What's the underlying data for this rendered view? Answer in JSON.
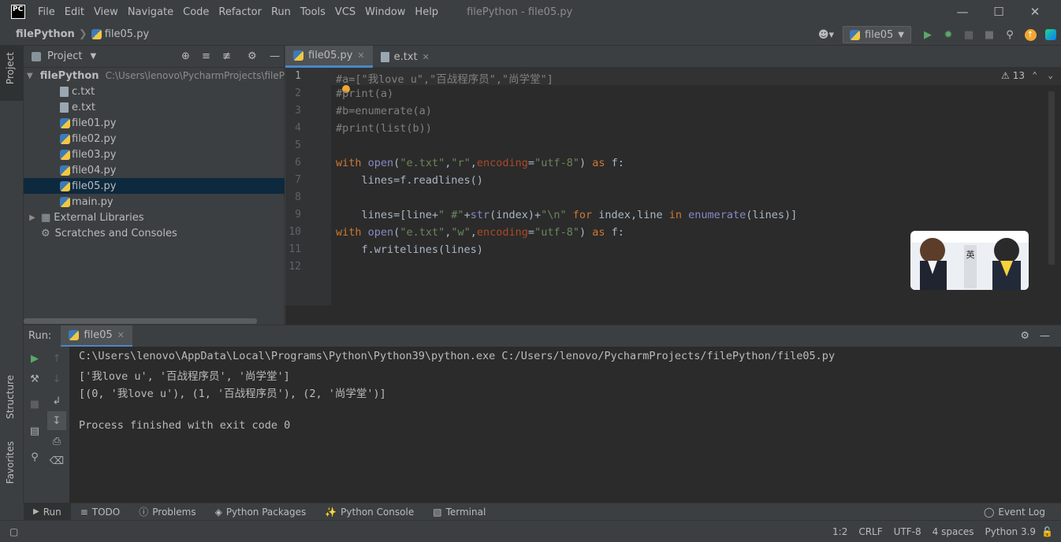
{
  "title_bar": {
    "logo": "PC",
    "menu": [
      "File",
      "Edit",
      "View",
      "Navigate",
      "Code",
      "Refactor",
      "Run",
      "Tools",
      "VCS",
      "Window",
      "Help"
    ],
    "window_title": "filePython - file05.py",
    "controls": [
      "minimize-icon",
      "maximize-icon",
      "close-icon"
    ]
  },
  "nav_bar": {
    "project": "filePython",
    "file": "file05.py",
    "run_config": "file05"
  },
  "left_stripe": {
    "tabs": [
      "Project",
      "Structure",
      "Favorites"
    ]
  },
  "project_panel": {
    "header": "Project",
    "root": {
      "name": "filePython",
      "path": "C:\\Users\\lenovo\\PycharmProjects\\fileP"
    },
    "files": [
      "c.txt",
      "e.txt",
      "file01.py",
      "file02.py",
      "file03.py",
      "file04.py",
      "file05.py",
      "main.py"
    ],
    "selected": "file05.py",
    "extra": [
      "External Libraries",
      "Scratches and Consoles"
    ]
  },
  "editor": {
    "tabs": [
      {
        "label": "file05.py",
        "active": true
      },
      {
        "label": "e.txt",
        "active": false
      }
    ],
    "warnings": "13",
    "line_numbers": [
      "1",
      "2",
      "3",
      "4",
      "5",
      "6",
      "7",
      "8",
      "9",
      "10",
      "11",
      "12"
    ],
    "lines": [
      "#a=[\"我love u\",\"百战程序员\",\"尚学堂\"]",
      "#print(a)",
      "#b=enumerate(a)",
      "#print(list(b))",
      "",
      "with open(\"e.txt\",\"r\",encoding=\"utf-8\") as f:",
      "    lines=f.readlines()",
      "",
      "    lines=[line+\" #\"+str(index)+\"\\n\" for index,line in enumerate(lines)]",
      "with open(\"e.txt\",\"w\",encoding=\"utf-8\") as f:",
      "    f.writelines(lines)",
      ""
    ]
  },
  "run_panel": {
    "label": "Run:",
    "tab": "file05",
    "output": [
      "C:\\Users\\lenovo\\AppData\\Local\\Programs\\Python\\Python39\\python.exe C:/Users/lenovo/PycharmProjects/filePython/file05.py",
      "['我love u', '百战程序员', '尚学堂']",
      "[(0, '我love u'), (1, '百战程序员'), (2, '尚学堂')]",
      "",
      "Process finished with exit code 0"
    ]
  },
  "bottom_tabs": [
    "Run",
    "TODO",
    "Problems",
    "Python Packages",
    "Python Console",
    "Terminal"
  ],
  "event_log": "Event Log",
  "status_bar": {
    "position": "1:2",
    "line_sep": "CRLF",
    "encoding": "UTF-8",
    "indent": "4 spaces",
    "interpreter": "Python 3.9"
  },
  "sticker": {
    "text": "英"
  },
  "colors": {
    "background": "#3c3f41",
    "editor": "#2b2b2b",
    "keyword": "#cc7832",
    "string": "#6a8759",
    "comment": "#808080",
    "selection": "#0d293e",
    "run_green": "#59a869"
  }
}
